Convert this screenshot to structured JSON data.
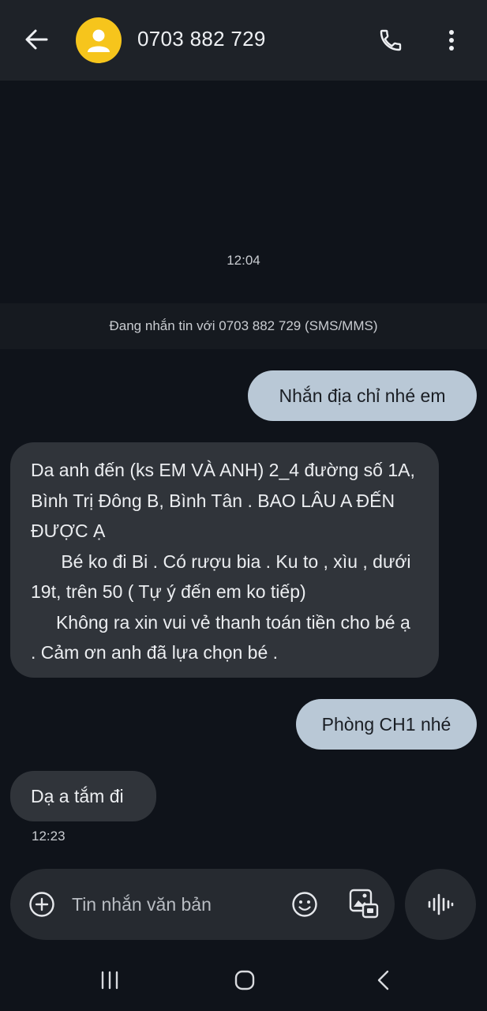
{
  "header": {
    "contact_name": "0703 882 729",
    "back_icon": "arrow-left-icon",
    "avatar_icon": "person-icon",
    "call_icon": "phone-icon",
    "more_icon": "more-vert-icon",
    "avatar_color": "#f6c51c"
  },
  "conversation": {
    "top_timestamp": "12:04",
    "info_banner": "Đang nhắn tin với 0703 882 729 (SMS/MMS)",
    "messages": [
      {
        "direction": "outgoing",
        "text": "Nhắn địa chỉ nhé em"
      },
      {
        "direction": "incoming",
        "text": "Da anh đến (ks EM VÀ ANH) 2_4 đường số 1A, Bình Trị Đông B, Bình Tân . BAO LÂU A ĐẾN ĐƯỢC Ạ\n      Bé ko đi Bi . Có rượu bia . Ku to , xìu , dưới 19t, trên 50 ( Tự ý đến em ko tiếp)\n     Không ra xin vui vẻ thanh toán tiền cho bé ạ . Cảm ơn anh đã lựa chọn bé ."
      },
      {
        "direction": "outgoing",
        "text": "Phòng CH1 nhé"
      },
      {
        "direction": "incoming",
        "text": "Dạ a tắm đi"
      }
    ],
    "last_timestamp": "12:23",
    "outgoing_color": "#b9c8d6",
    "incoming_color": "#30343a"
  },
  "composer": {
    "placeholder": "Tin nhắn văn bản",
    "add_icon": "plus-circle-icon",
    "emoji_icon": "emoji-icon",
    "gallery_icon": "gallery-icon",
    "voice_icon": "voice-waveform-icon"
  },
  "navigation": {
    "recents_icon": "recents-icon",
    "home_icon": "home-icon",
    "back_icon": "back-chevron-icon"
  }
}
